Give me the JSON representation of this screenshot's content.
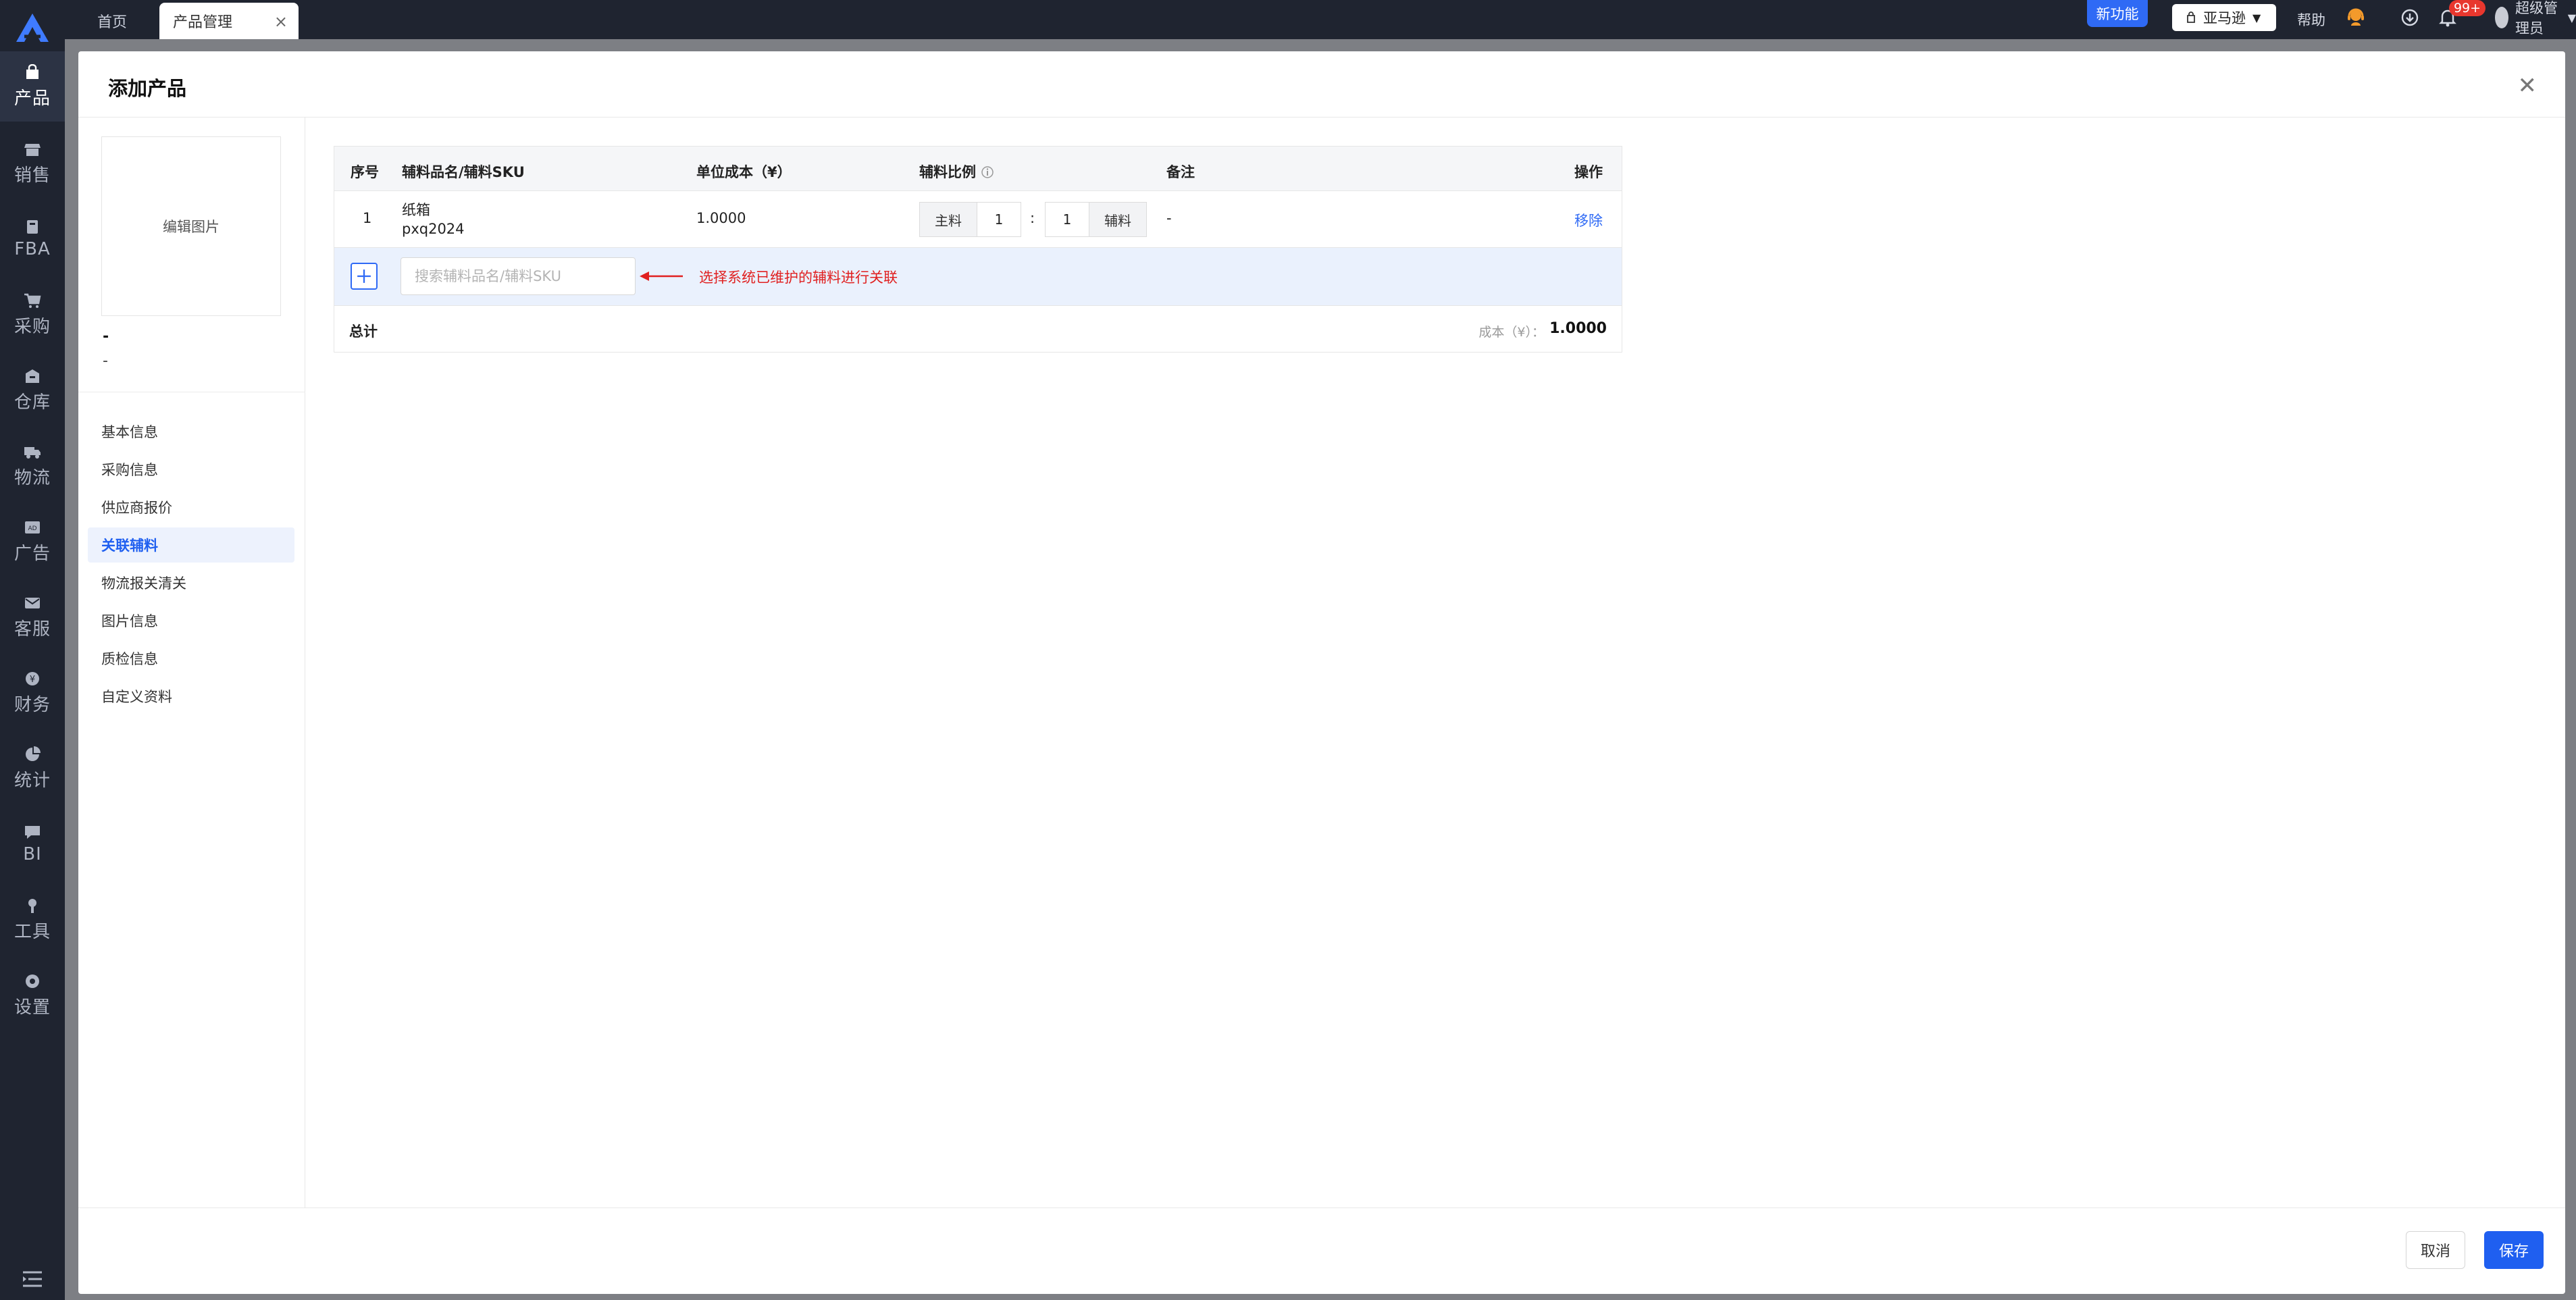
{
  "sidebar": {
    "items": [
      {
        "label": "产品",
        "icon": "bag-icon"
      },
      {
        "label": "销售",
        "icon": "store-icon"
      },
      {
        "label": "FBA",
        "icon": "box-icon"
      },
      {
        "label": "采购",
        "icon": "cart-icon"
      },
      {
        "label": "仓库",
        "icon": "warehouse-icon"
      },
      {
        "label": "物流",
        "icon": "truck-icon"
      },
      {
        "label": "广告",
        "icon": "ad-icon"
      },
      {
        "label": "客服",
        "icon": "mail-icon"
      },
      {
        "label": "财务",
        "icon": "yuan-icon"
      },
      {
        "label": "统计",
        "icon": "pie-chart-icon"
      },
      {
        "label": "BI",
        "icon": "bi-icon"
      },
      {
        "label": "工具",
        "icon": "wrench-icon"
      },
      {
        "label": "设置",
        "icon": "gear-icon"
      }
    ]
  },
  "topbar": {
    "tabs": [
      {
        "label": "首页"
      },
      {
        "label": "产品管理"
      }
    ],
    "tab_close": "×",
    "new_feature": "新功能",
    "site": "亚马逊",
    "help": "帮助",
    "notification_count": "99+",
    "user_name": "超级管理员"
  },
  "modal": {
    "title": "添加产品",
    "close": "✕",
    "cancel_label": "取消",
    "save_label": "保存"
  },
  "left_panel": {
    "edit_image": "编辑图片",
    "line1": "-",
    "line2": "-",
    "nav": [
      {
        "label": "基本信息"
      },
      {
        "label": "采购信息"
      },
      {
        "label": "供应商报价"
      },
      {
        "label": "关联辅料"
      },
      {
        "label": "物流报关清关"
      },
      {
        "label": "图片信息"
      },
      {
        "label": "质检信息"
      },
      {
        "label": "自定义资料"
      }
    ]
  },
  "table": {
    "headers": {
      "index": "序号",
      "name_sku": "辅料品名/辅料SKU",
      "unit_cost": "单位成本（¥）",
      "ratio": "辅料比例",
      "remark": "备注",
      "action": "操作"
    },
    "rows": [
      {
        "index": "1",
        "name": "纸箱",
        "sku": "pxq2024",
        "unit_cost": "1.0000",
        "main_label": "主料",
        "main_qty": "1",
        "colon": ":",
        "aux_qty": "1",
        "aux_label": "辅料",
        "remark": "-",
        "action": "移除"
      }
    ],
    "search_placeholder": "搜索辅料品名/辅料SKU",
    "annotation": "选择系统已维护的辅料进行关联",
    "total_label": "总计",
    "total_cost_label": "成本（¥）：",
    "total_cost_value": "1.0000"
  },
  "colors": {
    "accent": "#1f5ff0",
    "rail_bg": "#1f2430",
    "annotation": "#e02020",
    "badge": "#e8372e"
  }
}
